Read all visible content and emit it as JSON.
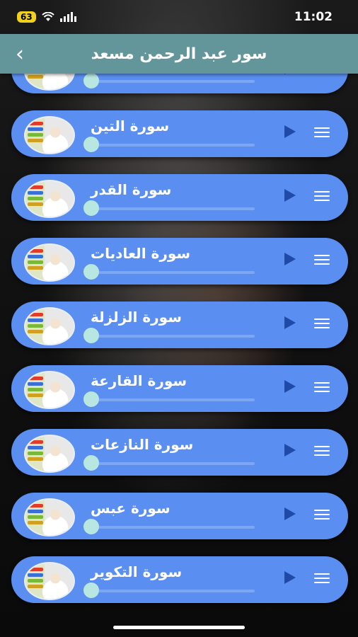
{
  "status_bar": {
    "battery": "63",
    "time": "11:02"
  },
  "header": {
    "back_icon": "chevron-left-icon",
    "title": "سور عبد الرحمن مسعد"
  },
  "surahs": [
    {
      "label": ""
    },
    {
      "label": "سورة التين"
    },
    {
      "label": "سورة القدر"
    },
    {
      "label": "سورة العاديات"
    },
    {
      "label": "سورة الزلزلة"
    },
    {
      "label": "سورة القارعة"
    },
    {
      "label": "سورة النازعات"
    },
    {
      "label": "سورة عبس"
    },
    {
      "label": "سورة التكوير"
    }
  ],
  "colors": {
    "header": "#62969a",
    "card": "#5a8ff1",
    "play": "#1f4aa8",
    "knob": "#b8e6e0"
  }
}
